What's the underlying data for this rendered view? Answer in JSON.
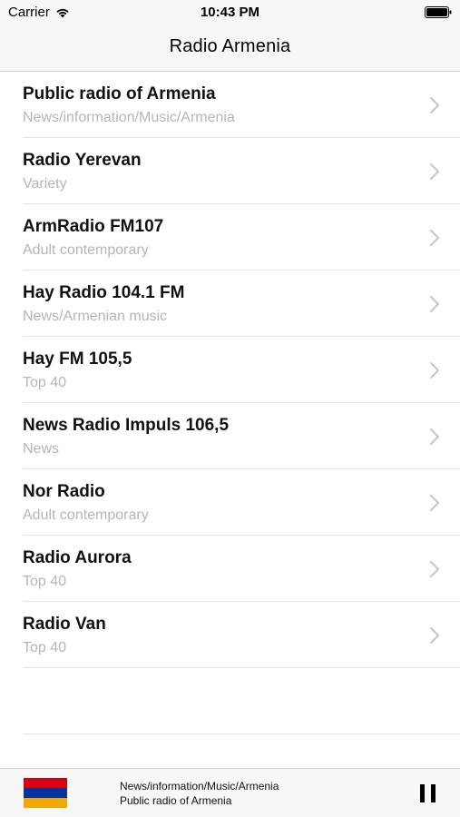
{
  "status_bar": {
    "carrier": "Carrier",
    "time": "10:43 PM",
    "icons": [
      "wifi-icon",
      "battery-icon"
    ]
  },
  "nav": {
    "title": "Radio Armenia"
  },
  "stations": [
    {
      "name": "Public radio of Armenia",
      "genre": "News/information/Music/Armenia"
    },
    {
      "name": "Radio Yerevan",
      "genre": "Variety"
    },
    {
      "name": "ArmRadio FM107",
      "genre": "Adult contemporary"
    },
    {
      "name": "Hay Radio 104.1 FM",
      "genre": "News/Armenian music"
    },
    {
      "name": "Hay FM 105,5",
      "genre": "Top 40"
    },
    {
      "name": "News Radio Impuls 106,5",
      "genre": "News"
    },
    {
      "name": "Nor Radio",
      "genre": "Adult contemporary"
    },
    {
      "name": "Radio Aurora",
      "genre": "Top 40"
    },
    {
      "name": "Radio Van",
      "genre": "Top 40"
    }
  ],
  "player": {
    "genre": "News/information/Music/Armenia",
    "station": "Public radio of Armenia",
    "flag_colors": [
      "#d90012",
      "#0033a0",
      "#f2a800"
    ],
    "state_icon": "pause-icon"
  },
  "colors": {
    "bar_background": "#f7f7f7",
    "subtitle_gray": "#b5b5b5",
    "chevron_gray": "#c7c7cc"
  }
}
